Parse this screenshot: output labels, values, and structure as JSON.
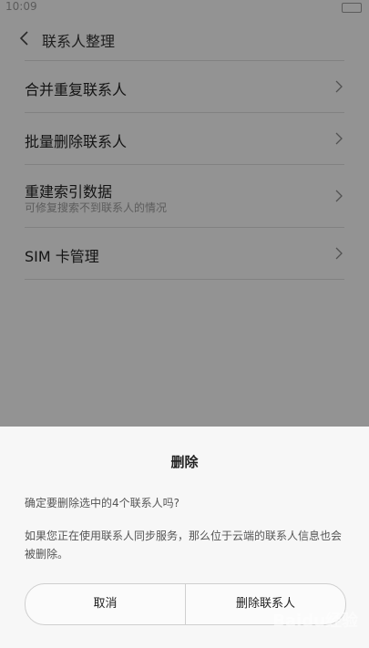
{
  "status_bar": {
    "time": "10:09"
  },
  "header": {
    "title": "联系人整理"
  },
  "list": {
    "items": [
      {
        "label": "合并重复联系人",
        "sub": ""
      },
      {
        "label": "批量删除联系人",
        "sub": ""
      },
      {
        "label": "重建索引数据",
        "sub": "可修复搜索不到联系人的情况"
      },
      {
        "label": "SIM 卡管理",
        "sub": ""
      }
    ]
  },
  "dialog": {
    "title": "删除",
    "message": "确定要删除选中的4个联系人吗?",
    "note": "如果您正在使用联系人同步服务，那么位于云端的联系人信息也会被删除。",
    "cancel_label": "取消",
    "delete_label": "删除联系人"
  },
  "watermark": {
    "text": "Baidu经验"
  }
}
